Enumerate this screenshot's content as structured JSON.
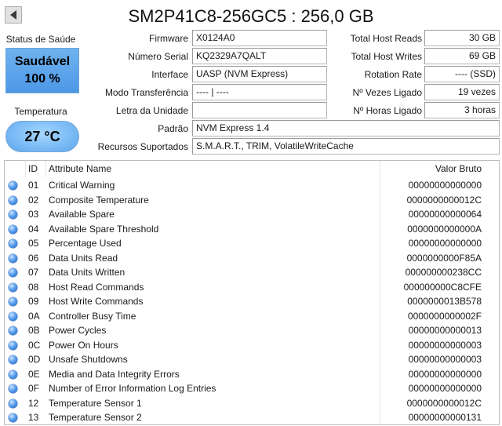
{
  "title": "SM2P41C8-256GC5 : 256,0 GB",
  "health": {
    "label": "Status de Saúde",
    "status": "Saudável",
    "percent": "100 %"
  },
  "temperature": {
    "label": "Temperatura",
    "value": "27 °C"
  },
  "info": {
    "firmware_label": "Firmware",
    "firmware": "X0124A0",
    "serial_label": "Número Serial",
    "serial": "KQ2329A7QALT",
    "interface_label": "Interface",
    "interface": "UASP (NVM Express)",
    "transfer_label": "Modo Transferência",
    "transfer": "---- | ----",
    "drive_letter_label": "Letra da Unidade",
    "drive_letter": "",
    "standard_label": "Padrão",
    "standard": "NVM Express 1.4",
    "features_label": "Recursos Suportados",
    "features": "S.M.A.R.T., TRIM, VolatileWriteCache"
  },
  "stats": {
    "host_reads_label": "Total Host Reads",
    "host_reads": "30 GB",
    "host_writes_label": "Total Host Writes",
    "host_writes": "69 GB",
    "rotation_label": "Rotation Rate",
    "rotation": "---- (SSD)",
    "power_count_label": "Nº Vezes Ligado",
    "power_count": "19 vezes",
    "power_hours_label": "Nº Horas Ligado",
    "power_hours": "3 horas"
  },
  "table": {
    "headers": {
      "id": "ID",
      "name": "Attribute Name",
      "raw": "Valor Bruto"
    },
    "rows": [
      {
        "id": "01",
        "name": "Critical Warning",
        "raw": "00000000000000"
      },
      {
        "id": "02",
        "name": "Composite Temperature",
        "raw": "0000000000012C"
      },
      {
        "id": "03",
        "name": "Available Spare",
        "raw": "00000000000064"
      },
      {
        "id": "04",
        "name": "Available Spare Threshold",
        "raw": "0000000000000A"
      },
      {
        "id": "05",
        "name": "Percentage Used",
        "raw": "00000000000000"
      },
      {
        "id": "06",
        "name": "Data Units Read",
        "raw": "0000000000F85A"
      },
      {
        "id": "07",
        "name": "Data Units Written",
        "raw": "000000000238CC"
      },
      {
        "id": "08",
        "name": "Host Read Commands",
        "raw": "000000000C8CFE"
      },
      {
        "id": "09",
        "name": "Host Write Commands",
        "raw": "0000000013B578"
      },
      {
        "id": "0A",
        "name": "Controller Busy Time",
        "raw": "0000000000002F"
      },
      {
        "id": "0B",
        "name": "Power Cycles",
        "raw": "00000000000013"
      },
      {
        "id": "0C",
        "name": "Power On Hours",
        "raw": "00000000000003"
      },
      {
        "id": "0D",
        "name": "Unsafe Shutdowns",
        "raw": "00000000000003"
      },
      {
        "id": "0E",
        "name": "Media and Data Integrity Errors",
        "raw": "00000000000000"
      },
      {
        "id": "0F",
        "name": "Number of Error Information Log Entries",
        "raw": "00000000000000"
      },
      {
        "id": "12",
        "name": "Temperature Sensor 1",
        "raw": "0000000000012C"
      },
      {
        "id": "13",
        "name": "Temperature Sensor 2",
        "raw": "00000000000131"
      }
    ]
  },
  "colors": {
    "health_bg": "#4d97e6",
    "temp_bg": "#5aa6ee",
    "status_dot": "#1f63c8"
  }
}
